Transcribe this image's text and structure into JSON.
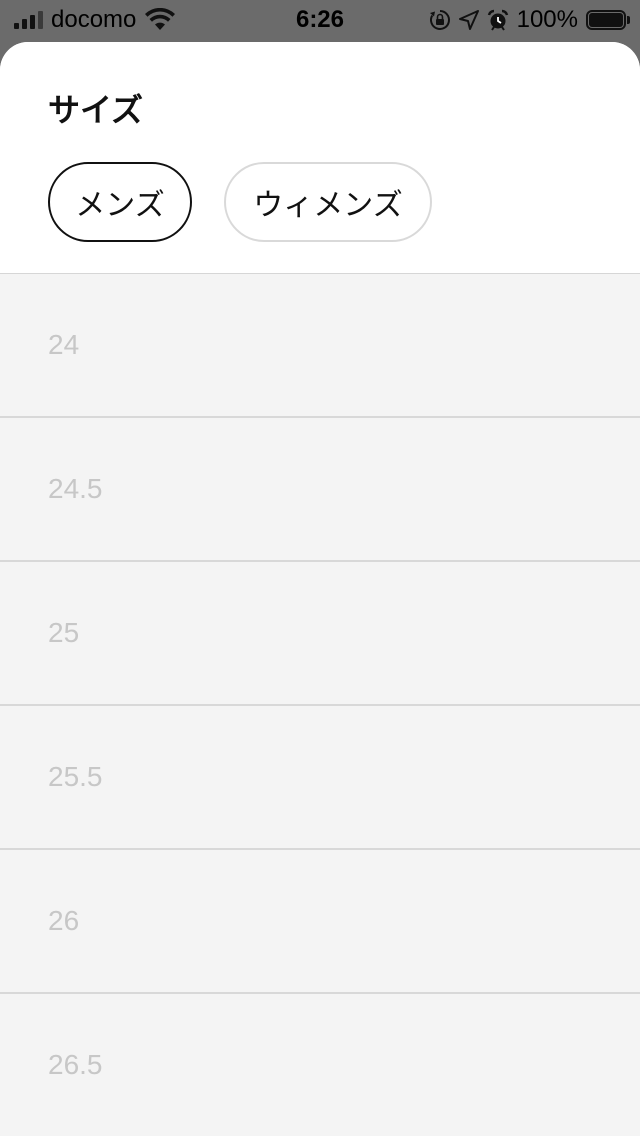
{
  "status_bar": {
    "carrier": "docomo",
    "time": "6:26",
    "battery_percent": "100%",
    "battery_level": 1.0,
    "icons": [
      "signal-icon",
      "wifi-icon",
      "orientation-lock-icon",
      "location-icon",
      "alarm-icon",
      "battery-icon"
    ]
  },
  "sheet": {
    "title": "サイズ",
    "segments": [
      {
        "label": "メンズ",
        "selected": true
      },
      {
        "label": "ウィメンズ",
        "selected": false
      }
    ],
    "sizes": [
      "24",
      "24.5",
      "25",
      "25.5",
      "26",
      "26.5"
    ]
  },
  "colors": {
    "sheet_background": "#ffffff",
    "list_background": "#f4f4f4",
    "dimmed_backdrop": "#6b6b6b",
    "size_text": "#c7c7c7",
    "selected_border": "#111111",
    "unselected_border": "#d9d9d9"
  }
}
